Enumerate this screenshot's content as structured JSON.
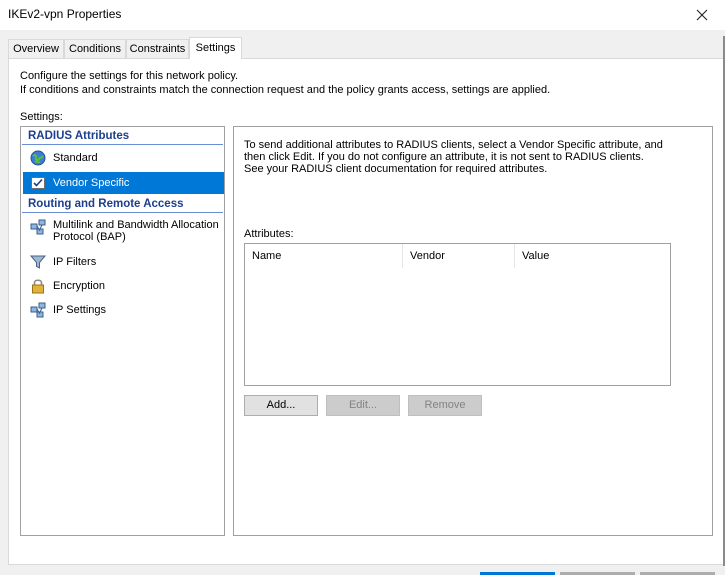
{
  "window": {
    "title": "IKEv2-vpn Properties"
  },
  "tabs": [
    {
      "label": "Overview"
    },
    {
      "label": "Conditions"
    },
    {
      "label": "Constraints"
    },
    {
      "label": "Settings"
    }
  ],
  "intro": {
    "line1": "Configure the settings for this network policy.",
    "line2": "If conditions and constraints match the connection request and the policy grants access, settings are applied."
  },
  "settings_label": "Settings:",
  "tree": {
    "radius_header": "RADIUS Attributes",
    "radius_items": [
      {
        "label": "Standard",
        "icon": "globe-icon"
      },
      {
        "label": "Vendor Specific",
        "icon": "checkbox-document-icon",
        "selected": true
      }
    ],
    "routing_header": "Routing and Remote Access",
    "routing_items": [
      {
        "label": "Multilink and Bandwidth Allocation Protocol (BAP)",
        "icon": "network-icon"
      },
      {
        "label": "IP Filters",
        "icon": "funnel-icon"
      },
      {
        "label": "Encryption",
        "icon": "lock-icon"
      },
      {
        "label": "IP Settings",
        "icon": "network-icon"
      }
    ]
  },
  "detail": {
    "description": "To send additional attributes to RADIUS clients, select a Vendor Specific attribute, and then click Edit. If you do not configure an attribute, it is not sent to RADIUS clients. See your RADIUS client documentation for required attributes.",
    "attributes_label": "Attributes:",
    "columns": [
      "Name",
      "Vendor",
      "Value"
    ],
    "buttons": {
      "add": "Add...",
      "edit": "Edit...",
      "remove": "Remove"
    }
  },
  "colors": {
    "selection": "#0078d7",
    "header_text": "#1e3f8f"
  }
}
